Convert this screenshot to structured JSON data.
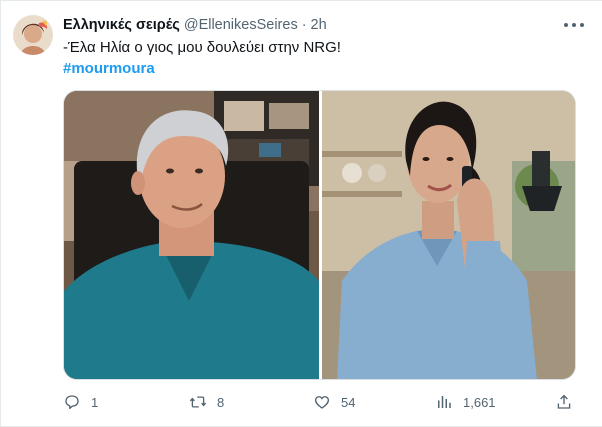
{
  "tweet": {
    "author_name": "Ελληνικές σειρές",
    "handle": "@EllenikesSeires",
    "separator": "·",
    "time": "2h",
    "text": "-Έλα Ηλία ο γιος μου δουλεύει στην NRG!",
    "hashtag": "#mourmoura"
  },
  "actions": {
    "reply_count": "1",
    "retweet_count": "8",
    "like_count": "54",
    "views_count": "1,661"
  },
  "icons": {
    "reply": "reply-icon",
    "retweet": "retweet-icon",
    "like": "heart-icon",
    "views": "analytics-icon",
    "share": "share-icon",
    "more": "more-icon"
  },
  "colors": {
    "hashtag": "#1d9bf0",
    "secondary_text": "#536471",
    "text": "#0f1419"
  }
}
